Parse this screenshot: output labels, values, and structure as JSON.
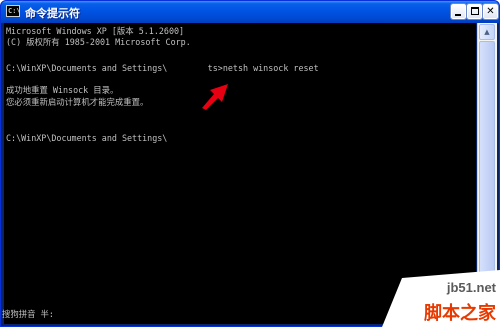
{
  "window": {
    "title": "命令提示符",
    "icon_text": "C:\\",
    "icon_name": "console-app-icon",
    "buttons": {
      "minimize": "minimize-icon",
      "maximize": "maximize-icon",
      "close": "close-icon",
      "close_glyph": "✕"
    }
  },
  "console": {
    "lines": [
      "Microsoft Windows XP [版本 5.1.2600]",
      "(C) 版权所有 1985-2001 Microsoft Corp.",
      "",
      "C:\\WinXP\\Documents and Settings\\        ts>netsh winsock reset",
      "",
      "成功地重置 Winsock 目录。",
      "您必须重新启动计算机才能完成重置。",
      "",
      "",
      "C:\\WinXP\\Documents and Settings\\"
    ],
    "ime_status": "搜狗拼音 半:"
  },
  "scrollbar": {
    "up_glyph": "▲",
    "down_glyph": "▼"
  },
  "annotation": {
    "color": "#e60012"
  },
  "watermark": {
    "url": "jb51.net",
    "brand": "脚本之家"
  },
  "colors": {
    "titlebar": "#0055e5",
    "console_bg": "#000000",
    "console_text": "#c0c0c0",
    "brand": "#e83a00"
  }
}
